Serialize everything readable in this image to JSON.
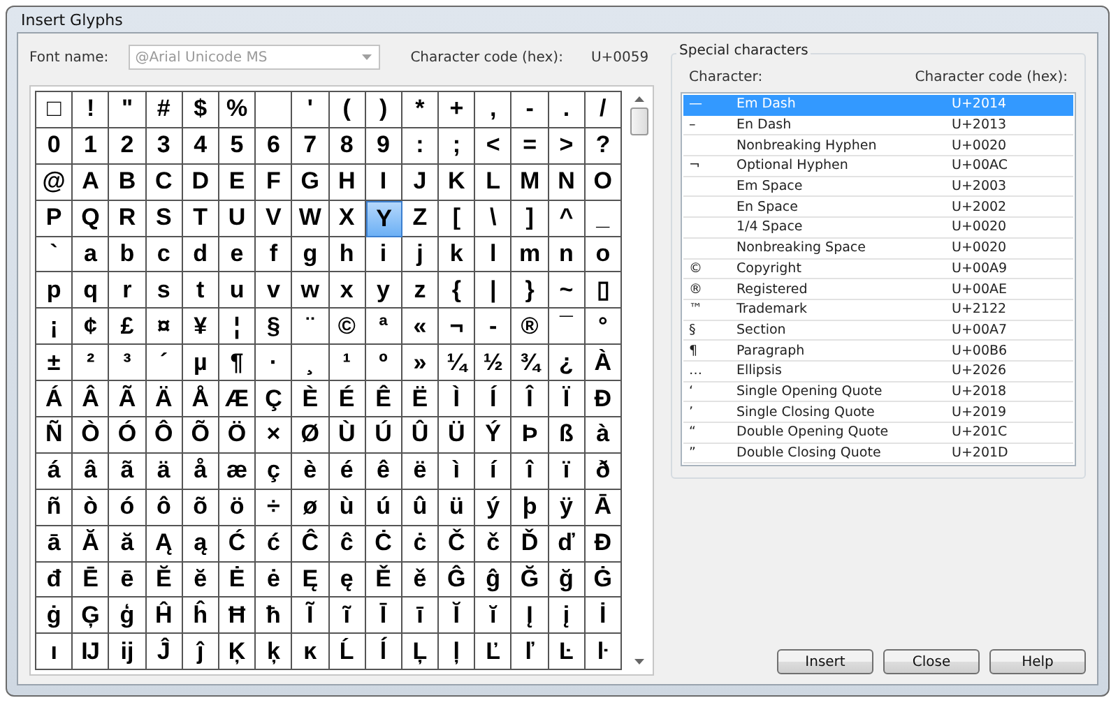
{
  "window": {
    "title": "Insert Glyphs"
  },
  "font_field": {
    "label": "Font name:",
    "value": "@Arial Unicode MS",
    "disabled": true
  },
  "code_label": "Character code (hex):",
  "code_value": "U+0059",
  "glyph_rows": [
    [
      {
        "g": "□",
        "selected": false
      },
      {
        "g": "!",
        "selected": false
      },
      {
        "g": "\"",
        "selected": false
      },
      {
        "g": "#",
        "selected": false
      },
      {
        "g": "$",
        "selected": false
      },
      {
        "g": "%",
        "selected": false
      },
      {
        "selected": false
      },
      {
        "g": "'",
        "selected": false
      },
      {
        "g": "(",
        "selected": false
      },
      {
        "g": ")",
        "selected": false
      },
      {
        "g": "*",
        "selected": false
      },
      {
        "g": "+",
        "selected": false
      },
      {
        "g": ",",
        "selected": false
      },
      {
        "g": "-",
        "selected": false
      },
      {
        "g": ".",
        "selected": false
      },
      {
        "g": "/",
        "selected": false
      }
    ],
    [
      {
        "g": "0",
        "selected": false
      },
      {
        "g": "1",
        "selected": false
      },
      {
        "g": "2",
        "selected": false
      },
      {
        "g": "3",
        "selected": false
      },
      {
        "g": "4",
        "selected": false
      },
      {
        "g": "5",
        "selected": false
      },
      {
        "g": "6",
        "selected": false
      },
      {
        "g": "7",
        "selected": false
      },
      {
        "g": "8",
        "selected": false
      },
      {
        "g": "9",
        "selected": false
      },
      {
        "g": ":",
        "selected": false
      },
      {
        "g": ";",
        "selected": false
      },
      {
        "g": "<",
        "selected": false
      },
      {
        "g": "=",
        "selected": false
      },
      {
        "g": ">",
        "selected": false
      },
      {
        "g": "?",
        "selected": false
      }
    ],
    [
      {
        "g": "@",
        "selected": false
      },
      {
        "g": "A",
        "selected": false
      },
      {
        "g": "B",
        "selected": false
      },
      {
        "g": "C",
        "selected": false
      },
      {
        "g": "D",
        "selected": false
      },
      {
        "g": "E",
        "selected": false
      },
      {
        "g": "F",
        "selected": false
      },
      {
        "g": "G",
        "selected": false
      },
      {
        "g": "H",
        "selected": false
      },
      {
        "g": "I",
        "selected": false
      },
      {
        "g": "J",
        "selected": false
      },
      {
        "g": "K",
        "selected": false
      },
      {
        "g": "L",
        "selected": false
      },
      {
        "g": "M",
        "selected": false
      },
      {
        "g": "N",
        "selected": false
      },
      {
        "g": "O",
        "selected": false
      }
    ],
    [
      {
        "g": "P",
        "selected": false
      },
      {
        "g": "Q",
        "selected": false
      },
      {
        "g": "R",
        "selected": false
      },
      {
        "g": "S",
        "selected": false
      },
      {
        "g": "T",
        "selected": false
      },
      {
        "g": "U",
        "selected": false
      },
      {
        "g": "V",
        "selected": false
      },
      {
        "g": "W",
        "selected": false
      },
      {
        "g": "X",
        "selected": false
      },
      {
        "g": "Y",
        "selected": true
      },
      {
        "g": "Z",
        "selected": false
      },
      {
        "g": "[",
        "selected": false
      },
      {
        "g": "\\",
        "selected": false
      },
      {
        "g": "]",
        "selected": false
      },
      {
        "g": "^",
        "selected": false
      },
      {
        "g": "_",
        "selected": false
      }
    ],
    [
      {
        "g": "`",
        "selected": false
      },
      {
        "g": "a",
        "selected": false
      },
      {
        "g": "b",
        "selected": false
      },
      {
        "g": "c",
        "selected": false
      },
      {
        "g": "d",
        "selected": false
      },
      {
        "g": "e",
        "selected": false
      },
      {
        "g": "f",
        "selected": false
      },
      {
        "g": "g",
        "selected": false
      },
      {
        "g": "h",
        "selected": false
      },
      {
        "g": "i",
        "selected": false
      },
      {
        "g": "j",
        "selected": false
      },
      {
        "g": "k",
        "selected": false
      },
      {
        "g": "l",
        "selected": false
      },
      {
        "g": "m",
        "selected": false
      },
      {
        "g": "n",
        "selected": false
      },
      {
        "g": "o",
        "selected": false
      }
    ],
    [
      {
        "g": "p",
        "selected": false
      },
      {
        "g": "q",
        "selected": false
      },
      {
        "g": "r",
        "selected": false
      },
      {
        "g": "s",
        "selected": false
      },
      {
        "g": "t",
        "selected": false
      },
      {
        "g": "u",
        "selected": false
      },
      {
        "g": "v",
        "selected": false
      },
      {
        "g": "w",
        "selected": false
      },
      {
        "g": "x",
        "selected": false
      },
      {
        "g": "y",
        "selected": false
      },
      {
        "g": "z",
        "selected": false
      },
      {
        "g": "{",
        "selected": false
      },
      {
        "g": "|",
        "selected": false
      },
      {
        "g": "}",
        "selected": false
      },
      {
        "g": "~",
        "selected": false
      },
      {
        "g": "▯",
        "selected": false
      }
    ],
    [
      {
        "g": "¡",
        "selected": false
      },
      {
        "g": "¢",
        "selected": false
      },
      {
        "g": "£",
        "selected": false
      },
      {
        "g": "¤",
        "selected": false
      },
      {
        "g": "¥",
        "selected": false
      },
      {
        "g": "¦",
        "selected": false
      },
      {
        "g": "§",
        "selected": false
      },
      {
        "g": "¨",
        "selected": false
      },
      {
        "g": "©",
        "selected": false
      },
      {
        "g": "ª",
        "selected": false
      },
      {
        "g": "«",
        "selected": false
      },
      {
        "g": "¬",
        "selected": false
      },
      {
        "g": "-",
        "selected": false
      },
      {
        "g": "®",
        "selected": false
      },
      {
        "g": "¯",
        "selected": false
      },
      {
        "g": "°",
        "selected": false
      }
    ],
    [
      {
        "g": "±",
        "selected": false
      },
      {
        "g": "²",
        "selected": false
      },
      {
        "g": "³",
        "selected": false
      },
      {
        "g": "´",
        "selected": false
      },
      {
        "g": "µ",
        "selected": false
      },
      {
        "g": "¶",
        "selected": false
      },
      {
        "g": "·",
        "selected": false
      },
      {
        "g": "¸",
        "selected": false
      },
      {
        "g": "¹",
        "selected": false
      },
      {
        "g": "º",
        "selected": false
      },
      {
        "g": "»",
        "selected": false
      },
      {
        "g": "¼",
        "selected": false
      },
      {
        "g": "½",
        "selected": false
      },
      {
        "g": "¾",
        "selected": false
      },
      {
        "g": "¿",
        "selected": false
      },
      {
        "g": "À",
        "selected": false
      }
    ],
    [
      {
        "g": "Á",
        "selected": false
      },
      {
        "g": "Â",
        "selected": false
      },
      {
        "g": "Ã",
        "selected": false
      },
      {
        "g": "Ä",
        "selected": false
      },
      {
        "g": "Å",
        "selected": false
      },
      {
        "g": "Æ",
        "selected": false
      },
      {
        "g": "Ç",
        "selected": false
      },
      {
        "g": "È",
        "selected": false
      },
      {
        "g": "É",
        "selected": false
      },
      {
        "g": "Ê",
        "selected": false
      },
      {
        "g": "Ë",
        "selected": false
      },
      {
        "g": "Ì",
        "selected": false
      },
      {
        "g": "Í",
        "selected": false
      },
      {
        "g": "Î",
        "selected": false
      },
      {
        "g": "Ï",
        "selected": false
      },
      {
        "g": "Ð",
        "selected": false
      }
    ],
    [
      {
        "g": "Ñ",
        "selected": false
      },
      {
        "g": "Ò",
        "selected": false
      },
      {
        "g": "Ó",
        "selected": false
      },
      {
        "g": "Ô",
        "selected": false
      },
      {
        "g": "Õ",
        "selected": false
      },
      {
        "g": "Ö",
        "selected": false
      },
      {
        "g": "×",
        "selected": false
      },
      {
        "g": "Ø",
        "selected": false
      },
      {
        "g": "Ù",
        "selected": false
      },
      {
        "g": "Ú",
        "selected": false
      },
      {
        "g": "Û",
        "selected": false
      },
      {
        "g": "Ü",
        "selected": false
      },
      {
        "g": "Ý",
        "selected": false
      },
      {
        "g": "Þ",
        "selected": false
      },
      {
        "g": "ß",
        "selected": false
      },
      {
        "g": "à",
        "selected": false
      }
    ],
    [
      {
        "g": "á",
        "selected": false
      },
      {
        "g": "â",
        "selected": false
      },
      {
        "g": "ã",
        "selected": false
      },
      {
        "g": "ä",
        "selected": false
      },
      {
        "g": "å",
        "selected": false
      },
      {
        "g": "æ",
        "selected": false
      },
      {
        "g": "ç",
        "selected": false
      },
      {
        "g": "è",
        "selected": false
      },
      {
        "g": "é",
        "selected": false
      },
      {
        "g": "ê",
        "selected": false
      },
      {
        "g": "ë",
        "selected": false
      },
      {
        "g": "ì",
        "selected": false
      },
      {
        "g": "í",
        "selected": false
      },
      {
        "g": "î",
        "selected": false
      },
      {
        "g": "ï",
        "selected": false
      },
      {
        "g": "ð",
        "selected": false
      }
    ],
    [
      {
        "g": "ñ",
        "selected": false
      },
      {
        "g": "ò",
        "selected": false
      },
      {
        "g": "ó",
        "selected": false
      },
      {
        "g": "ô",
        "selected": false
      },
      {
        "g": "õ",
        "selected": false
      },
      {
        "g": "ö",
        "selected": false
      },
      {
        "g": "÷",
        "selected": false
      },
      {
        "g": "ø",
        "selected": false
      },
      {
        "g": "ù",
        "selected": false
      },
      {
        "g": "ú",
        "selected": false
      },
      {
        "g": "û",
        "selected": false
      },
      {
        "g": "ü",
        "selected": false
      },
      {
        "g": "ý",
        "selected": false
      },
      {
        "g": "þ",
        "selected": false
      },
      {
        "g": "ÿ",
        "selected": false
      },
      {
        "g": "Ā",
        "selected": false
      }
    ],
    [
      {
        "g": "ā",
        "selected": false
      },
      {
        "g": "Ă",
        "selected": false
      },
      {
        "g": "ă",
        "selected": false
      },
      {
        "g": "Ą",
        "selected": false
      },
      {
        "g": "ą",
        "selected": false
      },
      {
        "g": "Ć",
        "selected": false
      },
      {
        "g": "ć",
        "selected": false
      },
      {
        "g": "Ĉ",
        "selected": false
      },
      {
        "g": "ĉ",
        "selected": false
      },
      {
        "g": "Ċ",
        "selected": false
      },
      {
        "g": "ċ",
        "selected": false
      },
      {
        "g": "Č",
        "selected": false
      },
      {
        "g": "č",
        "selected": false
      },
      {
        "g": "Ď",
        "selected": false
      },
      {
        "g": "ď",
        "selected": false
      },
      {
        "g": "Đ",
        "selected": false
      }
    ],
    [
      {
        "g": "đ",
        "selected": false
      },
      {
        "g": "Ē",
        "selected": false
      },
      {
        "g": "ē",
        "selected": false
      },
      {
        "g": "Ĕ",
        "selected": false
      },
      {
        "g": "ĕ",
        "selected": false
      },
      {
        "g": "Ė",
        "selected": false
      },
      {
        "g": "ė",
        "selected": false
      },
      {
        "g": "Ę",
        "selected": false
      },
      {
        "g": "ę",
        "selected": false
      },
      {
        "g": "Ě",
        "selected": false
      },
      {
        "g": "ě",
        "selected": false
      },
      {
        "g": "Ĝ",
        "selected": false
      },
      {
        "g": "ĝ",
        "selected": false
      },
      {
        "g": "Ğ",
        "selected": false
      },
      {
        "g": "ğ",
        "selected": false
      },
      {
        "g": "Ġ",
        "selected": false
      }
    ],
    [
      {
        "g": "ġ",
        "selected": false
      },
      {
        "g": "Ģ",
        "selected": false
      },
      {
        "g": "ģ",
        "selected": false
      },
      {
        "g": "Ĥ",
        "selected": false
      },
      {
        "g": "ĥ",
        "selected": false
      },
      {
        "g": "Ħ",
        "selected": false
      },
      {
        "g": "ħ",
        "selected": false
      },
      {
        "g": "Ĩ",
        "selected": false
      },
      {
        "g": "ĩ",
        "selected": false
      },
      {
        "g": "Ī",
        "selected": false
      },
      {
        "g": "ī",
        "selected": false
      },
      {
        "g": "Ĭ",
        "selected": false
      },
      {
        "g": "ĭ",
        "selected": false
      },
      {
        "g": "Į",
        "selected": false
      },
      {
        "g": "į",
        "selected": false
      },
      {
        "g": "İ",
        "selected": false
      }
    ],
    [
      {
        "g": "ı",
        "selected": false
      },
      {
        "g": "Ĳ",
        "selected": false
      },
      {
        "g": "ĳ",
        "selected": false
      },
      {
        "g": "Ĵ",
        "selected": false
      },
      {
        "g": "ĵ",
        "selected": false
      },
      {
        "g": "Ķ",
        "selected": false
      },
      {
        "g": "ķ",
        "selected": false
      },
      {
        "g": "ĸ",
        "selected": false
      },
      {
        "g": "Ĺ",
        "selected": false
      },
      {
        "g": "ĺ",
        "selected": false
      },
      {
        "g": "Ļ",
        "selected": false
      },
      {
        "g": "ļ",
        "selected": false
      },
      {
        "g": "Ľ",
        "selected": false
      },
      {
        "g": "ľ",
        "selected": false
      },
      {
        "g": "Ŀ",
        "selected": false
      },
      {
        "g": "ŀ",
        "selected": false
      }
    ]
  ],
  "special": {
    "title": "Special characters",
    "columns": [
      "Character:",
      "Character code (hex):"
    ],
    "rows": [
      {
        "char": "—",
        "name": "Em Dash",
        "code": "U+2014",
        "selected": true
      },
      {
        "char": "–",
        "name": "En Dash",
        "code": "U+2013",
        "selected": false
      },
      {
        "name": "Nonbreaking Hyphen",
        "code": "U+0020",
        "selected": false
      },
      {
        "char": "¬",
        "name": "Optional Hyphen",
        "code": "U+00AC",
        "selected": false
      },
      {
        "name": "Em Space",
        "code": "U+2003",
        "selected": false
      },
      {
        "name": "En Space",
        "code": "U+2002",
        "selected": false
      },
      {
        "name": "1/4 Space",
        "code": "U+0020",
        "selected": false
      },
      {
        "name": "Nonbreaking Space",
        "code": "U+0020",
        "selected": false
      },
      {
        "char": "©",
        "name": "Copyright",
        "code": "U+00A9",
        "selected": false
      },
      {
        "char": "®",
        "name": "Registered",
        "code": "U+00AE",
        "selected": false
      },
      {
        "char": "™",
        "name": "Trademark",
        "code": "U+2122",
        "selected": false
      },
      {
        "char": "§",
        "name": "Section",
        "code": "U+00A7",
        "selected": false
      },
      {
        "char": "¶",
        "name": "Paragraph",
        "code": "U+00B6",
        "selected": false
      },
      {
        "char": "…",
        "name": "Ellipsis",
        "code": "U+2026",
        "selected": false
      },
      {
        "char": "‘",
        "name": "Single Opening Quote",
        "code": "U+2018",
        "selected": false
      },
      {
        "char": "’",
        "name": "Single Closing Quote",
        "code": "U+2019",
        "selected": false
      },
      {
        "char": "“",
        "name": "Double Opening Quote",
        "code": "U+201C",
        "selected": false
      },
      {
        "char": "”",
        "name": "Double Closing Quote",
        "code": "U+201D",
        "selected": false
      }
    ]
  },
  "buttons": [
    "Insert",
    "Close",
    "Help"
  ]
}
